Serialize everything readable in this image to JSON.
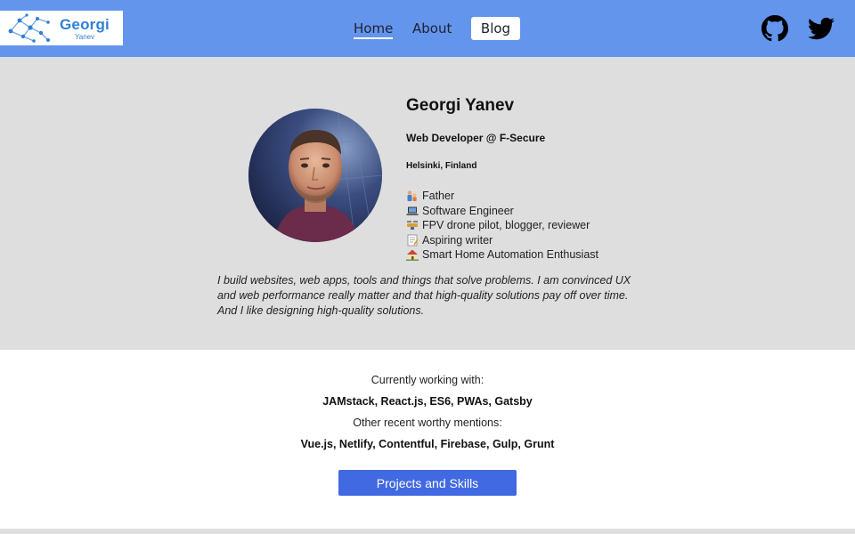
{
  "header": {
    "logo": {
      "name": "Georgi",
      "subtitle": "Yanev"
    },
    "nav": [
      {
        "label": "Home",
        "active": true
      },
      {
        "label": "About",
        "active": false
      },
      {
        "label": "Blog",
        "active": false
      }
    ],
    "social": {
      "github_icon": "github-icon",
      "twitter_icon": "twitter-icon"
    },
    "colors": {
      "header_bg": "#6495ed",
      "logo_text": "#2f7fd6"
    }
  },
  "profile": {
    "name": "Georgi Yanev",
    "role": "Web Developer @ F-Secure",
    "location": "Helsinki, Finland",
    "traits": [
      {
        "icon": "family-icon",
        "label": "Father"
      },
      {
        "icon": "laptop-icon",
        "label": " Software Engineer"
      },
      {
        "icon": "drone-icon",
        "label": " FPV drone pilot, blogger, reviewer"
      },
      {
        "icon": "memo-icon",
        "label": " Aspiring writer"
      },
      {
        "icon": "house-icon",
        "label": " Smart Home Automation Enthusiast"
      }
    ],
    "bio": "I build websites, web apps, tools and things that solve problems. I am convinced UX and web performance really matter and that high-quality solutions pay off over time. And I like designing high-quality solutions."
  },
  "skills": {
    "current_heading": "Currently working with:",
    "current_list": "JAMstack, React.js, ES6, PWAs, Gatsby",
    "other_heading": "Other recent worthy mentions:",
    "other_list": "Vue.js, Netlify, Contentful, Firebase, Gulp, Grunt",
    "button_label": "Projects and Skills",
    "colors": {
      "button_bg": "#4169e1",
      "section_bg": "#dedede"
    }
  }
}
